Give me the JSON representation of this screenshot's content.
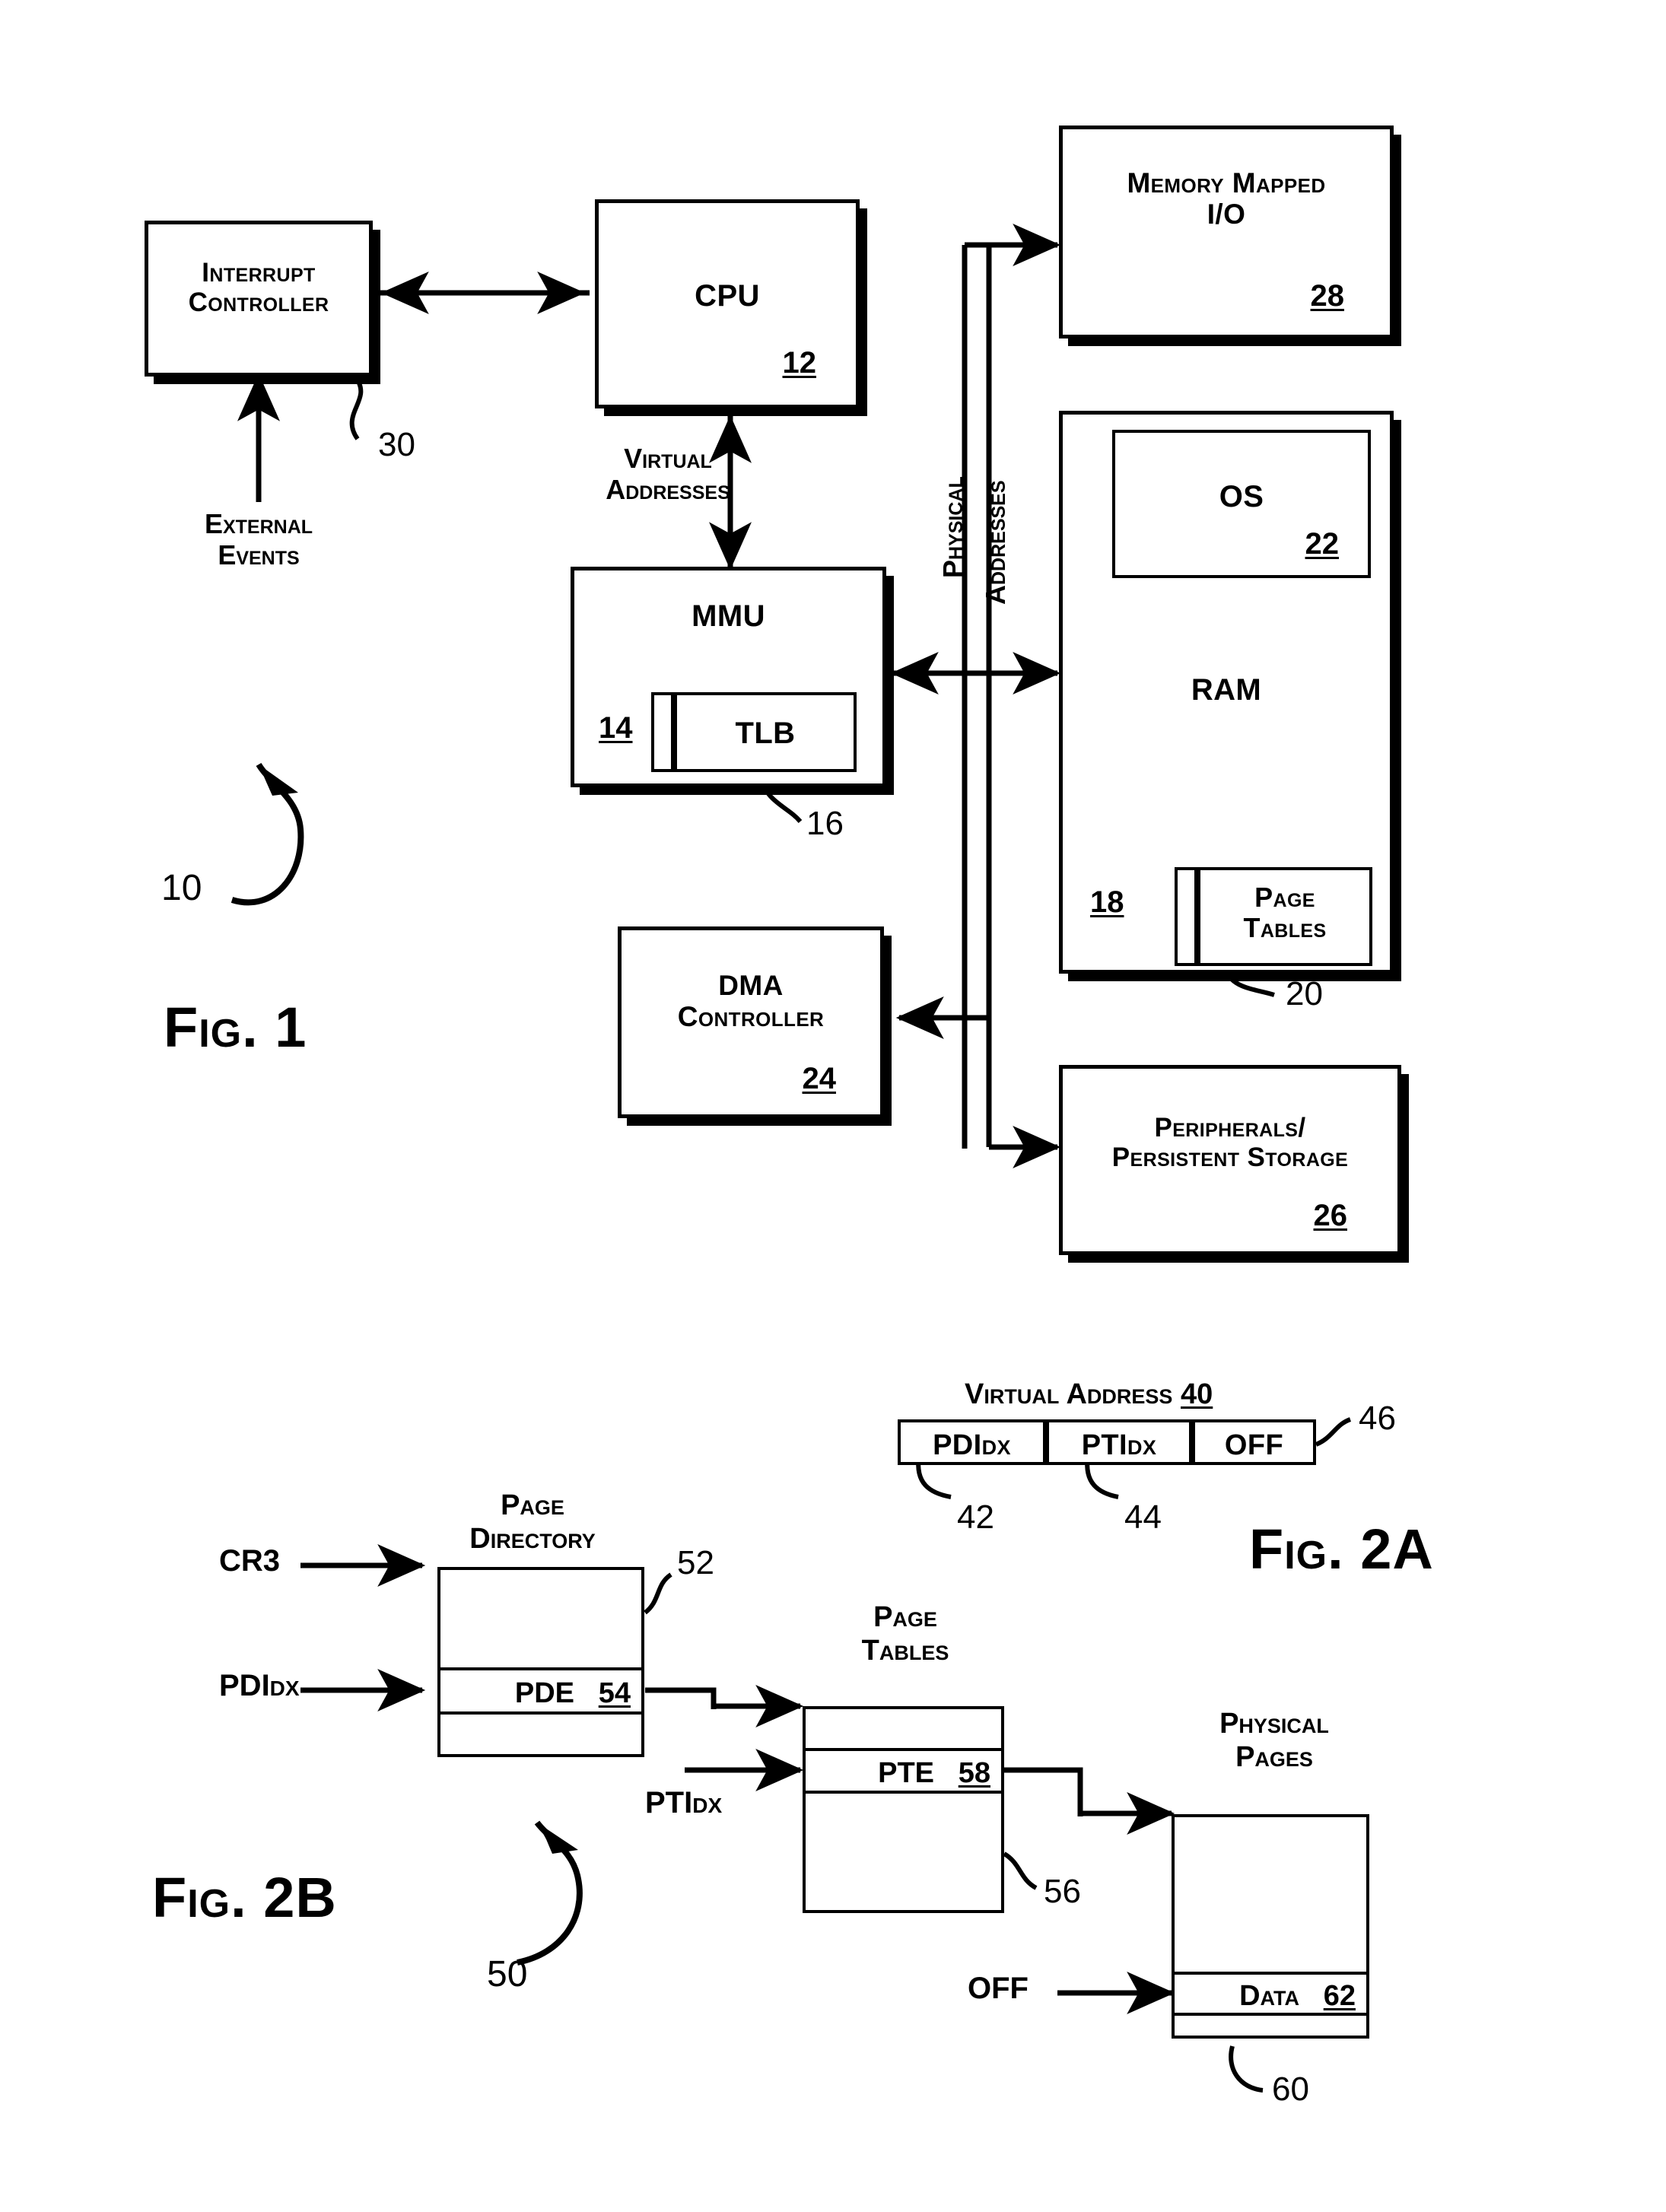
{
  "figures": [
    {
      "id": "fig1",
      "label": "Fig. 1",
      "system_ref": "10"
    },
    {
      "id": "fig2a",
      "label": "Fig. 2A"
    },
    {
      "id": "fig2b",
      "label": "Fig. 2B",
      "system_ref": "50"
    }
  ],
  "fig1": {
    "caption": "Fig. 1",
    "system_ref": "10",
    "blocks": {
      "interrupt_controller": {
        "label": "Interrupt\nController",
        "ref": "30"
      },
      "cpu": {
        "label": "CPU",
        "ref": "12"
      },
      "mmu": {
        "label": "MMU",
        "ref": "14"
      },
      "tlb": {
        "label": "TLB",
        "ref": "16"
      },
      "memory_mapped_io": {
        "label": "Memory Mapped\nI/O",
        "ref": "28"
      },
      "ram": {
        "label": "RAM",
        "ref": "18"
      },
      "os": {
        "label": "OS",
        "ref": "22"
      },
      "page_tables": {
        "label": "Page\nTables",
        "ref": "20"
      },
      "dma_controller": {
        "label": "DMA\nController",
        "ref": "24"
      },
      "peripherals": {
        "label": "Peripherals/\nPersistent Storage",
        "ref": "26"
      }
    },
    "edge_labels": {
      "external_events": "External\nEvents",
      "virtual_addresses": "Virtual\nAddresses",
      "physical": "Physical",
      "addresses": "Addresses"
    }
  },
  "fig2a": {
    "caption": "Fig. 2A",
    "title": "Virtual Address",
    "title_ref": "40",
    "word_ref": "46",
    "fields": [
      {
        "label": "PDIdx",
        "ref": "42"
      },
      {
        "label": "PTIdx",
        "ref": "44"
      },
      {
        "label": "OFF",
        "ref": ""
      }
    ]
  },
  "fig2b": {
    "caption": "Fig. 2B",
    "system_ref": "50",
    "inputs": {
      "cr3": "CR3",
      "pdidx": "PDIdx",
      "ptidx": "PTIdx",
      "off": "OFF"
    },
    "structures": [
      {
        "title": "Page\nDirectory",
        "ref": "52",
        "entry_label": "PDE",
        "entry_ref": "54"
      },
      {
        "title": "Page\nTables",
        "ref": "56",
        "entry_label": "PTE",
        "entry_ref": "58"
      },
      {
        "title": "Physical\nPages",
        "ref": "60",
        "entry_label": "Data",
        "entry_ref": "62"
      }
    ]
  }
}
